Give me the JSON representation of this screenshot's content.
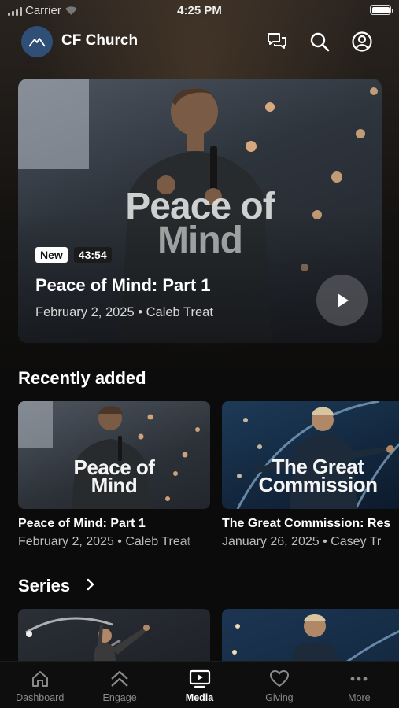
{
  "status_bar": {
    "carrier": "Carrier",
    "time": "4:25 PM"
  },
  "header": {
    "brand": "CF Church",
    "icons": [
      "chat-icon",
      "search-icon",
      "profile-icon"
    ]
  },
  "featured": {
    "art_title_line1": "Peace of",
    "art_title_line2": "Mind",
    "badge": "New",
    "duration": "43:54",
    "title": "Peace of Mind: Part 1",
    "meta": "February 2, 2025 • Caleb Treat"
  },
  "recently_added": {
    "heading": "Recently added",
    "items": [
      {
        "art_line1": "Peace of",
        "art_line2": "Mind",
        "title": "Peace of Mind: Part 1",
        "meta": "February 2, 2025 • Caleb Treat"
      },
      {
        "art_line1": "The Great",
        "art_line2": "Commission",
        "title": "The Great Commission: Res",
        "meta": "January 26, 2025 • Casey Tr"
      }
    ]
  },
  "series": {
    "heading": "Series"
  },
  "tabbar": {
    "active": "Media",
    "items": [
      {
        "label": "Dashboard",
        "icon": "home-icon"
      },
      {
        "label": "Engage",
        "icon": "chevrons-up-icon"
      },
      {
        "label": "Media",
        "icon": "play-screen-icon"
      },
      {
        "label": "Giving",
        "icon": "heart-icon"
      },
      {
        "label": "More",
        "icon": "more-icon"
      }
    ]
  },
  "colors": {
    "background": "#0b0b0b",
    "logo": "#2f4f77",
    "text": "#ffffff",
    "muted": "#8a8a8a"
  }
}
